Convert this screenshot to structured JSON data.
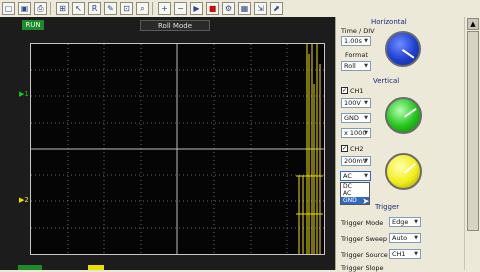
{
  "toolbar": {
    "icons": [
      "new-icon",
      "save-icon",
      "print-icon",
      "select-icon",
      "pointer-icon",
      "ruler-icon",
      "zoom-in-icon",
      "zoom-out-icon",
      "cursor-icon",
      "run-icon",
      "stop-icon",
      "settings-icon",
      "grid-icon",
      "export-icon"
    ]
  },
  "scope": {
    "run_label": "RUN",
    "mode_label": "Roll Mode",
    "ch1_marker": "1",
    "ch2_marker": "2"
  },
  "panel": {
    "horizontal_title": "Horizontal",
    "time_div_label": "Time / DIV",
    "time_div_value": "1.00s",
    "format_label": "Format",
    "format_value": "Roll",
    "vertical_title": "Vertical",
    "ch1_label": "CH1",
    "ch1_volts": "100V",
    "ch1_coupling": "GND",
    "ch1_probe": "x 1000",
    "ch2_label": "CH2",
    "ch2_volts": "200mV",
    "ch2_coupling": "AC",
    "dropdown_options": [
      "DC",
      "AC",
      "GND"
    ],
    "dropdown_selected_index": 2,
    "trigger_title": "Trigger",
    "trigger_mode_label": "Trigger Mode",
    "trigger_mode_value": "Edge",
    "trigger_sweep_label": "Trigger Sweep",
    "trigger_sweep_value": "Auto",
    "trigger_source_label": "Trigger Source",
    "trigger_source_value": "CH1",
    "trigger_slope_label": "Trigger Slope"
  },
  "colors": {
    "knob_time": "#1f3fd0",
    "knob_ch1": "#22c41b",
    "knob_ch2": "#f2ef1a",
    "trace_ch1": "#19c419",
    "trace_ch2": "#f0e000"
  }
}
